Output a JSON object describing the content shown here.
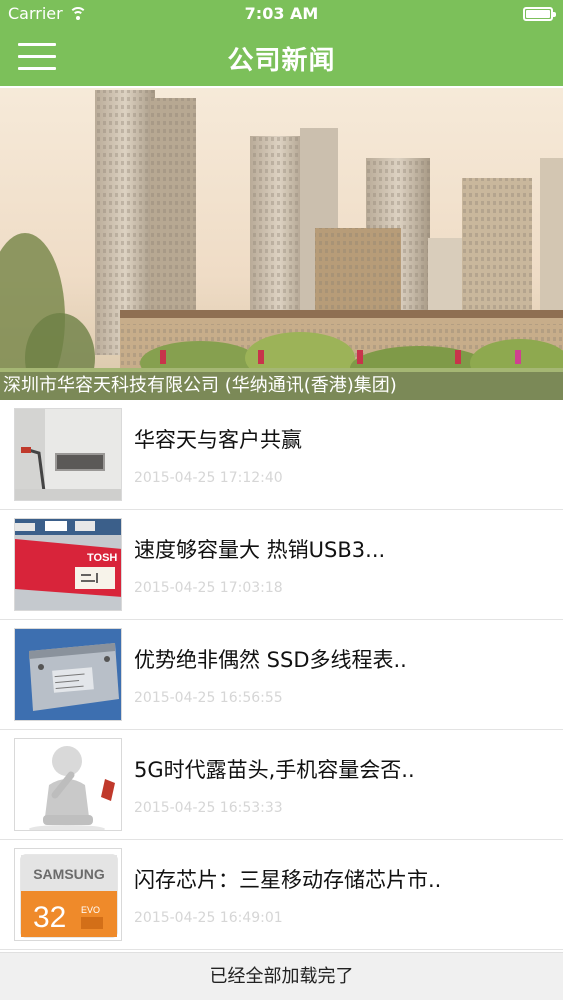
{
  "status_bar": {
    "carrier": "Carrier",
    "time": "7:03 AM",
    "wifi_icon": "wifi-icon",
    "battery_icon": "battery-icon"
  },
  "header": {
    "title": "公司新闻",
    "menu_icon": "hamburger-menu-icon",
    "color": "#7cc05a"
  },
  "banner": {
    "caption": "深圳市华容天科技有限公司 (华纳通讯(香港)集团)"
  },
  "news": [
    {
      "title": "华容天与客户共赢",
      "date": "2015-04-25 17:12:40",
      "thumb": "office-interior-thumbnail"
    },
    {
      "title": "速度够容量大 热销USB3...",
      "date": "2015-04-25 17:03:18",
      "thumb": "usb-drive-thumbnail"
    },
    {
      "title": "优势绝非偶然 SSD多线程表..",
      "date": "2015-04-25 16:56:55",
      "thumb": "hard-drive-thumbnail"
    },
    {
      "title": "5G时代露苗头,手机容量会否..",
      "date": "2015-04-25 16:53:33",
      "thumb": "thinking-figure-thumbnail"
    },
    {
      "title": "闪存芯片：三星移动存储芯片市..",
      "date": "2015-04-25 16:49:01",
      "thumb": "samsung-card-thumbnail"
    }
  ],
  "thumb_labels": {
    "toshiba": "TOSH",
    "samsung": "SAMSUNG",
    "capacity": "32",
    "evo": "EVO"
  },
  "footer": {
    "text": "已经全部加载完了"
  }
}
